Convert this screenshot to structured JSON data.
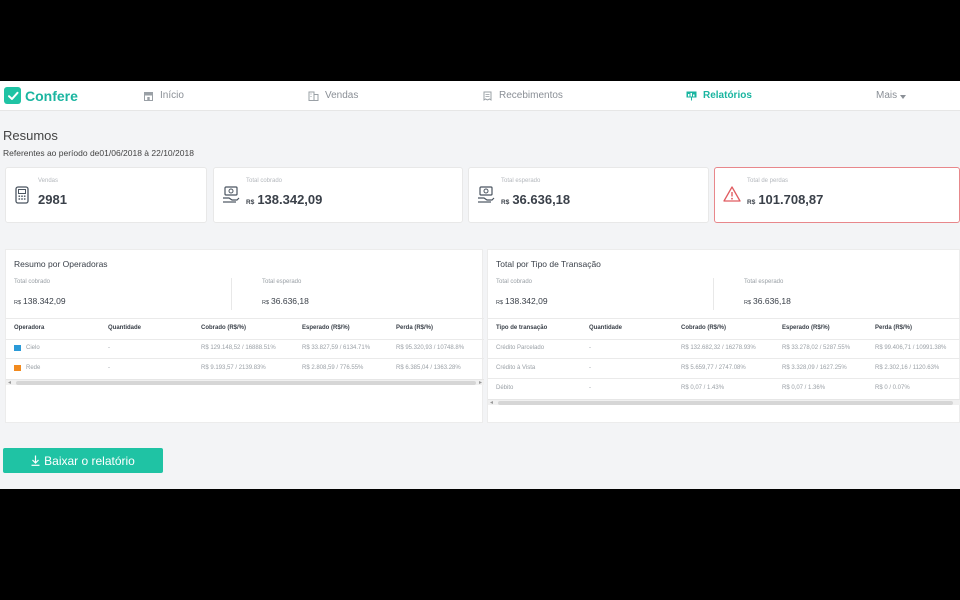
{
  "app": {
    "name": "Confere"
  },
  "nav": {
    "inicio": "Início",
    "vendas": "Vendas",
    "recebimentos": "Recebimentos",
    "relatorios": "Relatórios",
    "mais": "Mais"
  },
  "page": {
    "title": "Resumos",
    "subtitle": "Referentes ao período de01/06/2018 à 22/10/2018"
  },
  "cards": {
    "vendas": {
      "label": "Vendas",
      "value": "2981"
    },
    "cobrado": {
      "label": "Total cobrado",
      "currency": "R$",
      "value": "138.342,09"
    },
    "esperado": {
      "label": "Total esperado",
      "currency": "R$",
      "value": "36.636,18"
    },
    "perdas": {
      "label": "Total de perdas",
      "currency": "R$",
      "value": "101.708,87"
    }
  },
  "operadoras": {
    "title": "Resumo por Operadoras",
    "cobrado_label": "Total cobrado",
    "cobrado_currency": "R$",
    "cobrado_value": "138.342,09",
    "esperado_label": "Total esperado",
    "esperado_currency": "R$",
    "esperado_value": "36.636,18",
    "columns": [
      "Operadora",
      "Quantidade",
      "Cobrado (R$/%)",
      "Esperado (R$/%)",
      "Perda (R$/%)"
    ],
    "rows": [
      {
        "name": "Cielo",
        "qty": "-",
        "cobrado": "R$ 129.148,52 / 16888.51%",
        "esperado": "R$ 33.827,59 / 6134.71%",
        "perda": "R$ 95.320,93 / 10748.8%"
      },
      {
        "name": "Rede",
        "qty": "-",
        "cobrado": "R$ 9.193,57 / 2139.83%",
        "esperado": "R$ 2.808,59 / 776.55%",
        "perda": "R$ 6.385,04 / 1363.28%"
      }
    ]
  },
  "transacao": {
    "title": "Total por Tipo de Transação",
    "cobrado_label": "Total cobrado",
    "cobrado_currency": "R$",
    "cobrado_value": "138.342,09",
    "esperado_label": "Total esperado",
    "esperado_currency": "R$",
    "esperado_value": "36.636,18",
    "columns": [
      "Tipo de transação",
      "Quantidade",
      "Cobrado (R$/%)",
      "Esperado (R$/%)",
      "Perda (R$/%)"
    ],
    "rows": [
      {
        "name": "Crédito Parcelado",
        "qty": "-",
        "cobrado": "R$ 132.682,32 / 16278.93%",
        "esperado": "R$ 33.278,02 / 5287.55%",
        "perda": "R$ 99.406,71 / 10991.38%"
      },
      {
        "name": "Crédito à Vista",
        "qty": "-",
        "cobrado": "R$ 5.659,77 / 2747.08%",
        "esperado": "R$ 3.328,09 / 1627.25%",
        "perda": "R$ 2.302,16 / 1120.63%"
      },
      {
        "name": "Débito",
        "qty": "-",
        "cobrado": "R$ 0,07 / 1.43%",
        "esperado": "R$ 0,07 / 1.36%",
        "perda": "R$ 0 / 0.07%"
      }
    ]
  },
  "actions": {
    "download": "Baixar o relatório"
  },
  "colors": {
    "brand": "#1fc3a4",
    "alert": "#e05c61",
    "cielo": "#2a9ad8",
    "rede": "#f28a1e"
  }
}
